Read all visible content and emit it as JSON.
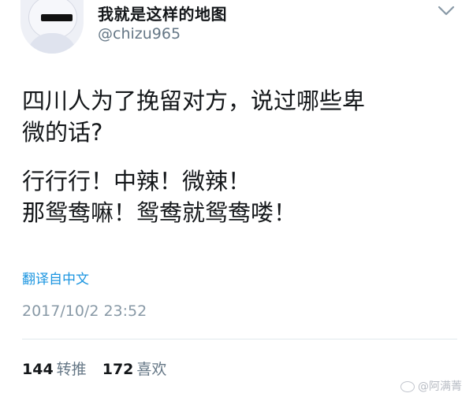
{
  "user": {
    "display_name": "我就是这样的地图",
    "handle": "@chizu965"
  },
  "tweet": {
    "line1": "四川人为了挽留对方，说过哪些卑",
    "line2": "微的话?",
    "line3": "行行行！中辣！微辣！",
    "line4": "那鸳鸯嘛！鸳鸯就鸳鸯喽！",
    "translate": "翻译自中文",
    "timestamp": "2017/10/2 23:52"
  },
  "stats": {
    "retweets_count": "144",
    "retweets_label": "转推",
    "likes_count": "172",
    "likes_label": "喜欢"
  },
  "watermark": {
    "text": "@阿满菁"
  },
  "icons": {
    "menu": "chevron-down-icon",
    "avatar": "avatar"
  }
}
